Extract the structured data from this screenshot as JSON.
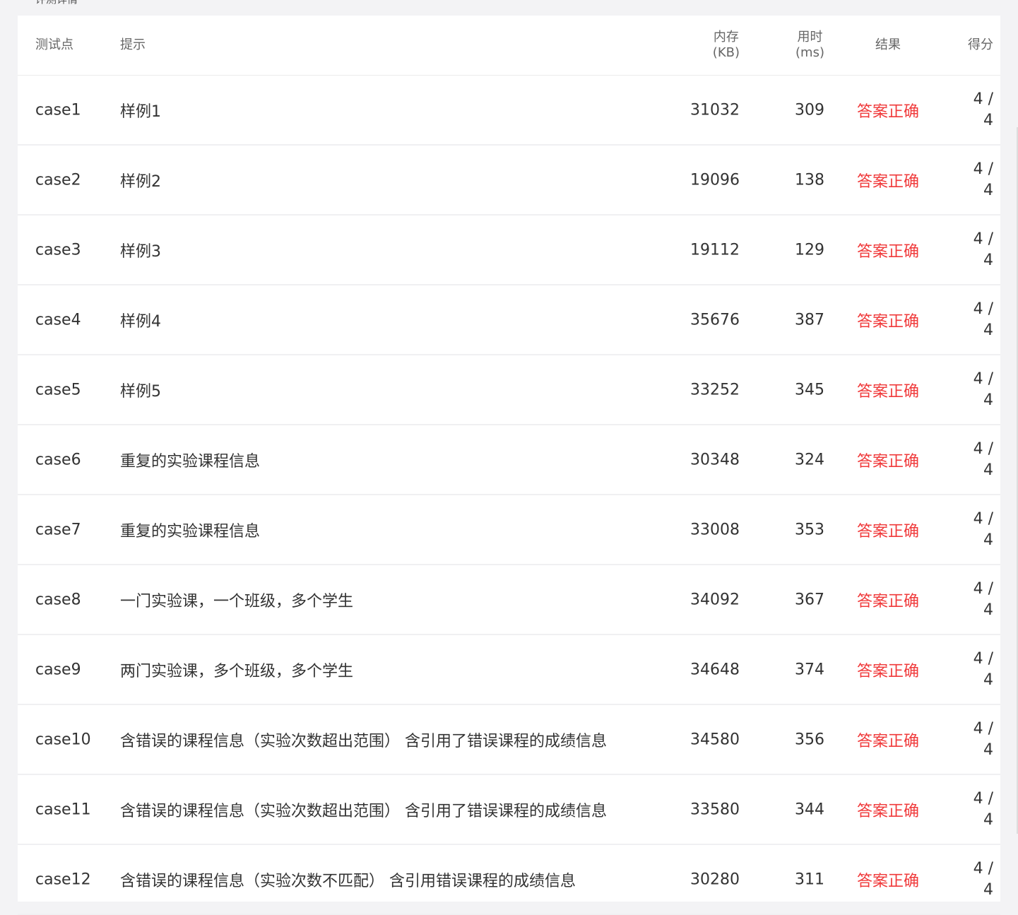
{
  "panel": {
    "title": "评测详情"
  },
  "header": {
    "case": "测试点",
    "hint": "提示",
    "memory_1": "内存",
    "memory_2": "(KB)",
    "time_1": "用时",
    "time_2": "(ms)",
    "result": "结果",
    "score": "得分"
  },
  "rows": [
    {
      "id": "case1",
      "hint": "样例1",
      "memory": "31032",
      "time": "309",
      "result": "答案正确",
      "score_a": "4 /",
      "score_b": "4"
    },
    {
      "id": "case2",
      "hint": "样例2",
      "memory": "19096",
      "time": "138",
      "result": "答案正确",
      "score_a": "4 /",
      "score_b": "4"
    },
    {
      "id": "case3",
      "hint": "样例3",
      "memory": "19112",
      "time": "129",
      "result": "答案正确",
      "score_a": "4 /",
      "score_b": "4"
    },
    {
      "id": "case4",
      "hint": "样例4",
      "memory": "35676",
      "time": "387",
      "result": "答案正确",
      "score_a": "4 /",
      "score_b": "4"
    },
    {
      "id": "case5",
      "hint": "样例5",
      "memory": "33252",
      "time": "345",
      "result": "答案正确",
      "score_a": "4 /",
      "score_b": "4"
    },
    {
      "id": "case6",
      "hint": "重复的实验课程信息",
      "memory": "30348",
      "time": "324",
      "result": "答案正确",
      "score_a": "4 /",
      "score_b": "4"
    },
    {
      "id": "case7",
      "hint": "重复的实验课程信息",
      "memory": "33008",
      "time": "353",
      "result": "答案正确",
      "score_a": "4 /",
      "score_b": "4"
    },
    {
      "id": "case8",
      "hint": "一门实验课，一个班级，多个学生",
      "memory": "34092",
      "time": "367",
      "result": "答案正确",
      "score_a": "4 /",
      "score_b": "4"
    },
    {
      "id": "case9",
      "hint": "两门实验课，多个班级，多个学生",
      "memory": "34648",
      "time": "374",
      "result": "答案正确",
      "score_a": "4 /",
      "score_b": "4"
    },
    {
      "id": "case10",
      "hint": "含错误的课程信息（实验次数超出范围） 含引用了错误课程的成绩信息",
      "memory": "34580",
      "time": "356",
      "result": "答案正确",
      "score_a": "4 /",
      "score_b": "4"
    },
    {
      "id": "case11",
      "hint": "含错误的课程信息（实验次数超出范围） 含引用了错误课程的成绩信息",
      "memory": "33580",
      "time": "344",
      "result": "答案正确",
      "score_a": "4 /",
      "score_b": "4"
    },
    {
      "id": "case12",
      "hint": "含错误的课程信息（实验次数不匹配） 含引用错误课程的成绩信息",
      "memory": "30280",
      "time": "311",
      "result": "答案正确",
      "score_a": "4 /",
      "score_b": "4"
    }
  ],
  "colors": {
    "result_ok": "#f0393a",
    "text": "#333333",
    "muted": "#666666",
    "background": "#f3f3f5"
  }
}
